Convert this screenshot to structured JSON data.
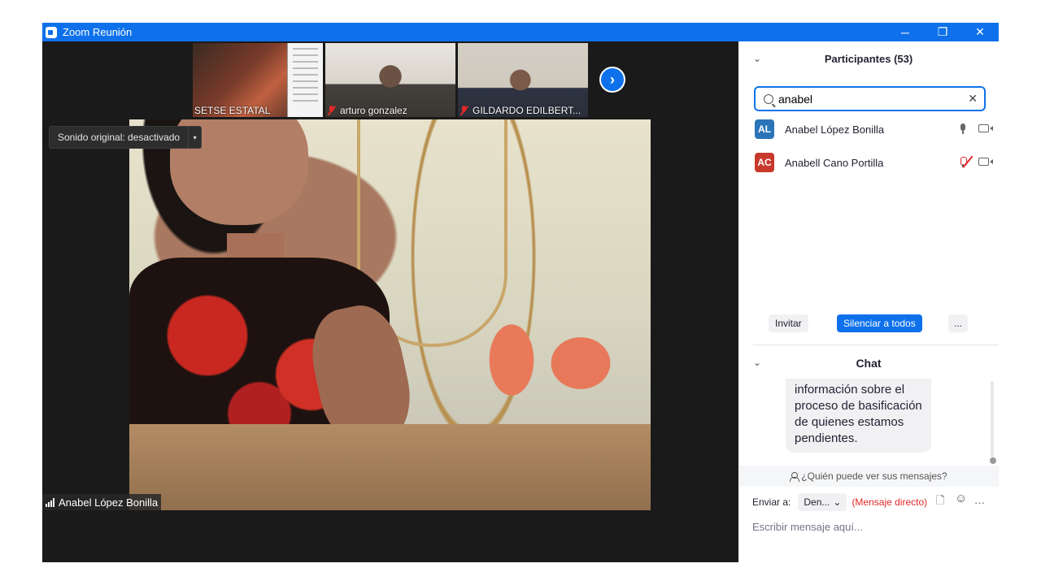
{
  "window": {
    "title": "Zoom Reunión",
    "controls": {
      "minimize": "─",
      "restore": "❐",
      "close": "✕"
    }
  },
  "thumbnails": [
    {
      "name": "SETSE ESTATAL",
      "muted": false
    },
    {
      "name": "arturo gonzalez",
      "muted": true
    },
    {
      "name": "GILDARDO EDILBERT...",
      "muted": true
    }
  ],
  "next_arrow": "›",
  "audio_dropdown": {
    "label": "Sonido original: desactivado",
    "caret": "▾"
  },
  "active_speaker": "Anabel López Bonilla",
  "participants": {
    "collapse": "⌄",
    "title": "Participantes (53)",
    "search": {
      "value": "anabel",
      "clear": "✕"
    },
    "list": [
      {
        "initials": "AL",
        "name": "Anabel López Bonilla",
        "color": "#2b74b8",
        "mic": "on"
      },
      {
        "initials": "AC",
        "name": "Anabell Cano Portilla",
        "color": "#c8392b",
        "mic": "muted"
      }
    ],
    "buttons": {
      "invite": "Invitar",
      "mute_all": "Silenciar a todos",
      "more": "..."
    }
  },
  "chat": {
    "collapse": "⌄",
    "title": "Chat",
    "message": "información sobre el proceso de basificación de quienes estamos pendientes.",
    "who_can_see": "¿Quién puede ver sus mensajes?",
    "send_to_label": "Enviar a:",
    "recipient": "Den...",
    "recipient_caret": "⌄",
    "direct_message": "(Mensaje directo)",
    "placeholder": "Escribir mensaje aquí...",
    "icons": {
      "file": "🗋",
      "emoji": "☺",
      "more": "···"
    }
  },
  "colors": {
    "accent": "#0e71eb",
    "muted_red": "#e02828"
  }
}
